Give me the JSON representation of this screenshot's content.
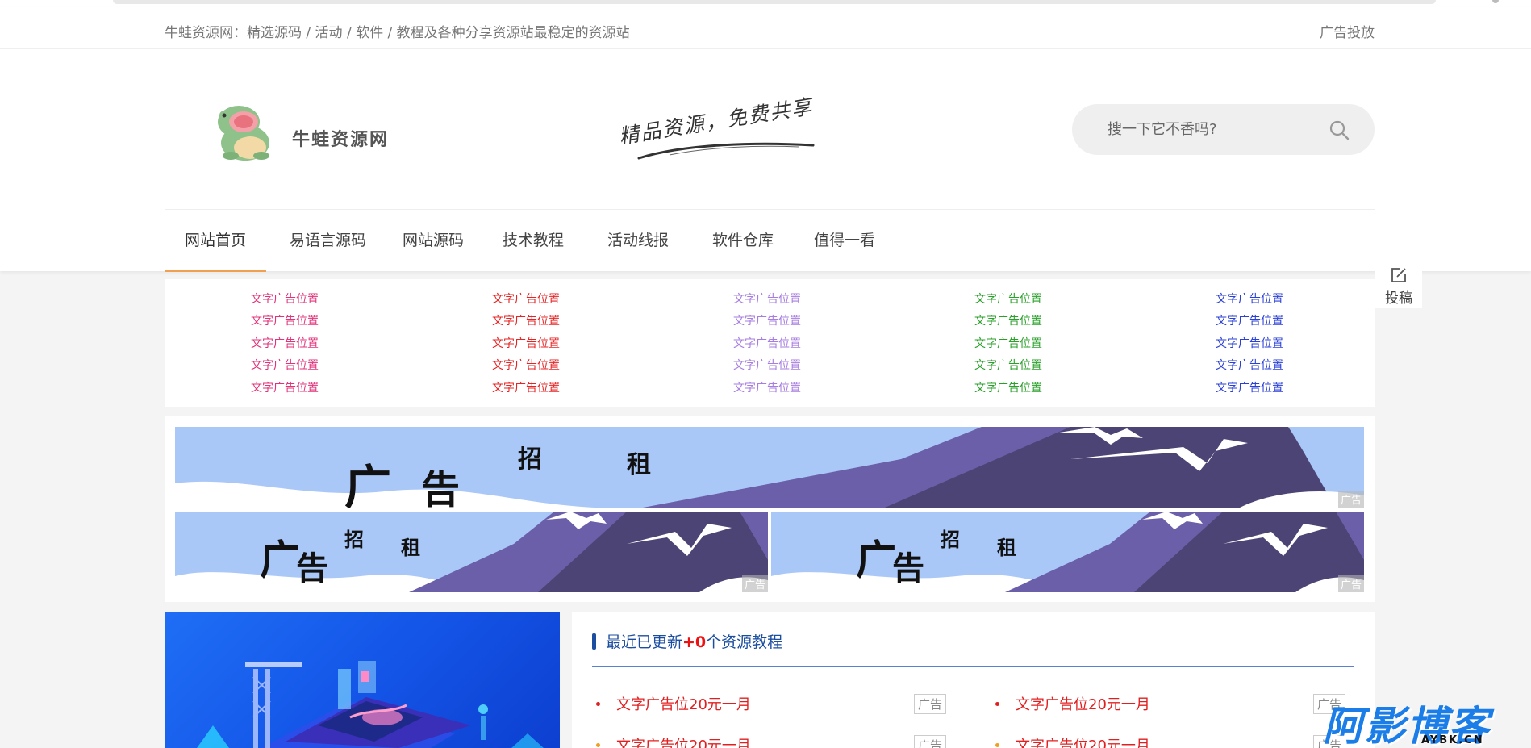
{
  "topbar": {
    "tagline": "牛蛙资源网：精选源码 / 活动 / 软件 / 教程及各种分享资源站最稳定的资源站",
    "ad_link": "广告投放"
  },
  "logo": {
    "text": "牛蛙资源网"
  },
  "slogan": {
    "text": "精品资源，免费共享"
  },
  "search": {
    "placeholder": "搜一下它不香吗?"
  },
  "nav": {
    "items": [
      "网站首页",
      "易语言源码",
      "网站源码",
      "技术教程",
      "活动线报",
      "软件仓库",
      "值得一看"
    ]
  },
  "submit_tool": {
    "label": "投稿"
  },
  "text_ads": {
    "label": "文字广告位置",
    "columns": [
      {
        "color": "#e0337a",
        "items": [
          "文字广告位置",
          "文字广告位置",
          "文字广告位置",
          "文字广告位置",
          "文字广告位置"
        ]
      },
      {
        "color": "#e52525",
        "items": [
          "文字广告位置",
          "文字广告位置",
          "文字广告位置",
          "文字广告位置",
          "文字广告位置"
        ]
      },
      {
        "color": "#a77de0",
        "items": [
          "文字广告位置",
          "文字广告位置",
          "文字广告位置",
          "文字广告位置",
          "文字广告位置"
        ]
      },
      {
        "color": "#2aa02a",
        "items": [
          "文字广告位置",
          "文字广告位置",
          "文字广告位置",
          "文字广告位置",
          "文字广告位置"
        ]
      },
      {
        "color": "#2a3fd6",
        "items": [
          "文字广告位置",
          "文字广告位置",
          "文字广告位置",
          "文字广告位置",
          "文字广告位置"
        ]
      }
    ]
  },
  "banners": {
    "words": [
      "广",
      "告",
      "招",
      "租"
    ],
    "tag": "广告"
  },
  "updates": {
    "title_prefix": "最近已更新",
    "count": "+0",
    "title_suffix": "个资源教程",
    "items": [
      {
        "text": "文字广告位20元一月",
        "badge": "广告",
        "bullet_color": "#e02020"
      },
      {
        "text": "文字广告位20元一月",
        "badge": "广告",
        "bullet_color": "#e02020"
      },
      {
        "text": "文字广告位20元一月",
        "badge": "广告",
        "bullet_color": "#f0a020"
      },
      {
        "text": "文字广告位20元一月",
        "badge": "广告",
        "bullet_color": "#f0a020"
      }
    ]
  },
  "watermark": {
    "big": "阿影博客",
    "small": "AYBK.CN"
  }
}
